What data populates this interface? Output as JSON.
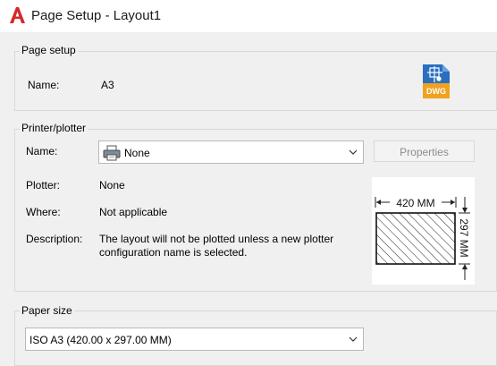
{
  "window": {
    "title": "Page Setup - Layout1"
  },
  "page_setup": {
    "legend": "Page setup",
    "name_label": "Name:",
    "name_value": "A3",
    "icon_text": "DWG"
  },
  "printer": {
    "legend": "Printer/plotter",
    "name_label": "Name:",
    "selected": "None",
    "properties_label": "Properties",
    "plotter_label": "Plotter:",
    "plotter_value": "None",
    "where_label": "Where:",
    "where_value": "Not applicable",
    "description_label": "Description:",
    "description_line1": "The layout will not be plotted unless a new plotter",
    "description_line2": "configuration name is selected."
  },
  "preview": {
    "width_label": "420  MM",
    "height_label": "297 MM"
  },
  "paper_size": {
    "legend": "Paper size",
    "selected": "ISO A3 (420.00 x 297.00 MM)"
  }
}
